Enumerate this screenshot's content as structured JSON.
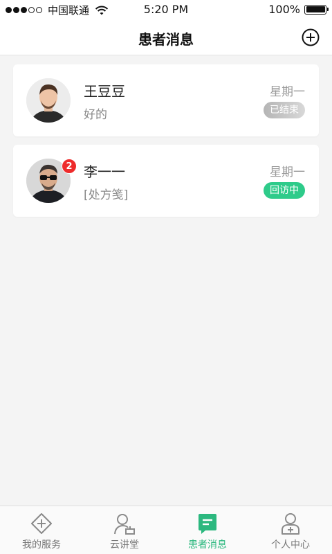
{
  "status_bar": {
    "carrier": "中国联通",
    "time": "5:20 PM",
    "battery": "100%",
    "signal_strength": 3,
    "battery_level": 1.0
  },
  "header": {
    "title": "患者消息",
    "add_icon": "plus-circle-icon"
  },
  "messages": [
    {
      "name": "王豆豆",
      "preview": "好的",
      "day": "星期一",
      "status": "已结束",
      "status_color": "#c4c4c4",
      "unread": ""
    },
    {
      "name": "李一一",
      "preview": "[处方笺]",
      "day": "星期一",
      "status": "回访中",
      "status_color": "#2ecb8a",
      "unread": "2"
    }
  ],
  "tabs": [
    {
      "label": "我的服务",
      "icon": "plus-diamond-icon",
      "active": false
    },
    {
      "label": "云讲堂",
      "icon": "lecture-user-icon",
      "active": false
    },
    {
      "label": "患者消息",
      "icon": "chat-bubble-icon",
      "active": true
    },
    {
      "label": "个人中心",
      "icon": "person-plus-icon",
      "active": false
    }
  ],
  "colors": {
    "accent": "#2cb87f",
    "badge": "#ee2b2b",
    "background": "#f4f4f4"
  }
}
